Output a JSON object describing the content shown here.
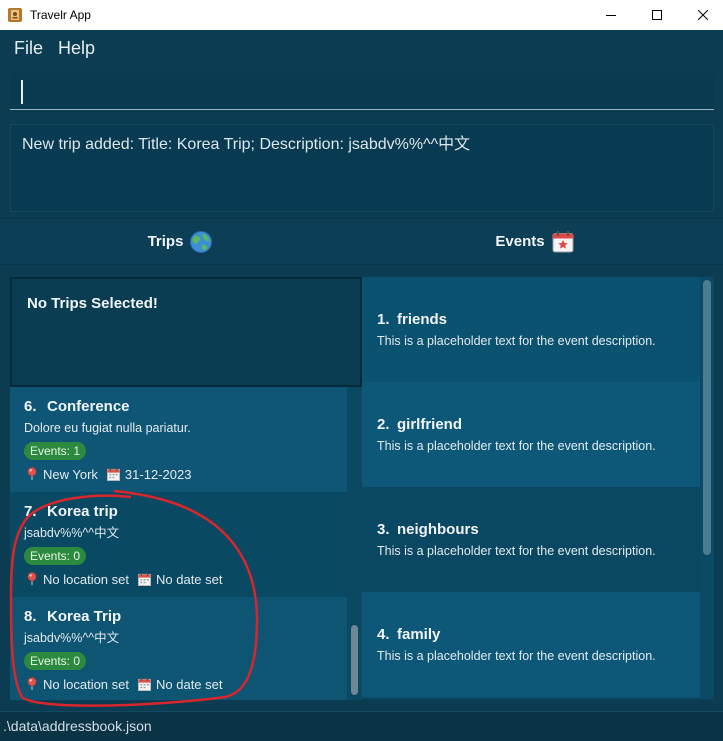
{
  "window": {
    "title": "Travelr App",
    "app_icon": "app-icon",
    "controls": [
      "minimize-icon",
      "maximize-icon",
      "close-icon"
    ]
  },
  "menu": {
    "items": [
      {
        "label": "File"
      },
      {
        "label": "Help"
      }
    ]
  },
  "command": {
    "value": ""
  },
  "result": {
    "text": "New trip added: Title: Korea Trip; Description: jsabdv%%^^中文"
  },
  "tabs": {
    "trips": {
      "label": "Trips",
      "icon": "globe-icon"
    },
    "events": {
      "label": "Events",
      "icon": "calendar-star-icon"
    }
  },
  "trips": {
    "selected_text": "No Trips Selected!",
    "items": [
      {
        "index": "6.",
        "title": "Conference",
        "description": "Dolore eu fugiat nulla pariatur.",
        "events": "Events: 1",
        "location": "New York",
        "date": "31-12-2023"
      },
      {
        "index": "7.",
        "title": "Korea trip",
        "description": "jsabdv%%^^中文",
        "events": "Events: 0",
        "location": "No location set",
        "date": "No date set"
      },
      {
        "index": "8.",
        "title": "Korea Trip",
        "description": "jsabdv%%^^中文",
        "events": "Events: 0",
        "location": "No location set",
        "date": "No date set"
      }
    ]
  },
  "events": {
    "items": [
      {
        "index": "1.",
        "title": "friends",
        "description": "This is a placeholder text for the event description."
      },
      {
        "index": "2.",
        "title": "girlfriend",
        "description": "This is a placeholder text for the event description."
      },
      {
        "index": "3.",
        "title": "neighbours",
        "description": "This is a placeholder text for the event description."
      },
      {
        "index": "4.",
        "title": "family",
        "description": "This is a placeholder text for the event description."
      }
    ]
  },
  "status": {
    "save_path": ".\\data\\addressbook.json"
  },
  "colors": {
    "window-bg": "#0b3c52",
    "badge-bg": "#2b8a3d",
    "annotation": "#d9262c"
  }
}
